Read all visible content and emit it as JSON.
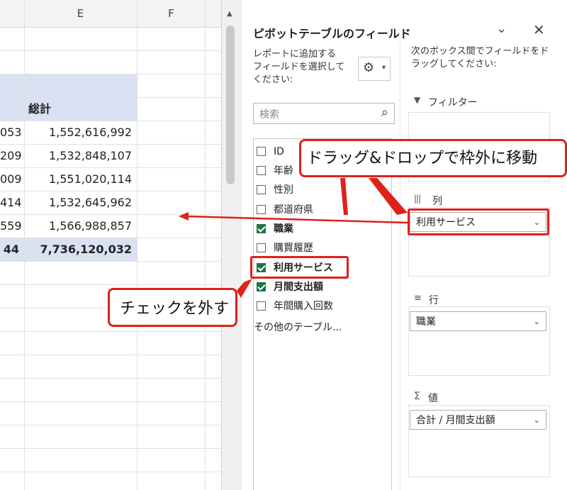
{
  "sheet": {
    "columns": [
      "E",
      "F"
    ],
    "total_header": "総計",
    "rows": [
      {
        "partial": "053",
        "total": "1,552,616,992"
      },
      {
        "partial": "209",
        "total": "1,532,848,107"
      },
      {
        "partial": "009",
        "total": "1,551,020,114"
      },
      {
        "partial": "414",
        "total": "1,532,645,962"
      },
      {
        "partial": "559",
        "total": "1,566,988,857"
      }
    ],
    "grand_partial": "44",
    "grand_total": "7,736,120,032"
  },
  "pane": {
    "title": "ピボットテーブルのフィールド",
    "add_prompt": "レポートに追加する\nフィールドを選択して\nください:",
    "drag_prompt": "次のボックス間でフィールドをド\nラッグしてください:",
    "search_placeholder": "検索",
    "fields": [
      {
        "label": "ID",
        "checked": false
      },
      {
        "label": "年齢",
        "checked": false
      },
      {
        "label": "性別",
        "checked": false
      },
      {
        "label": "都道府県",
        "checked": false
      },
      {
        "label": "職業",
        "checked": true
      },
      {
        "label": "購買履歴",
        "checked": false
      },
      {
        "label": "利用サービス",
        "checked": true
      },
      {
        "label": "月間支出額",
        "checked": true
      },
      {
        "label": "年間購入回数",
        "checked": false
      }
    ],
    "more_tables": "その他のテーブル...",
    "areas": {
      "filter_label": "フィルター",
      "columns_label": "列",
      "columns_value": "利用サービス",
      "rows_label": "行",
      "rows_value": "職業",
      "values_label": "値",
      "values_value": "合計 / 月間支出額"
    }
  },
  "callouts": {
    "drag": "ドラッグ&ドロップで枠外に移動",
    "uncheck": "チェックを外す"
  },
  "colors": {
    "accent": "#217346",
    "highlight": "#e0201a",
    "header_band": "#d9e1f2"
  }
}
